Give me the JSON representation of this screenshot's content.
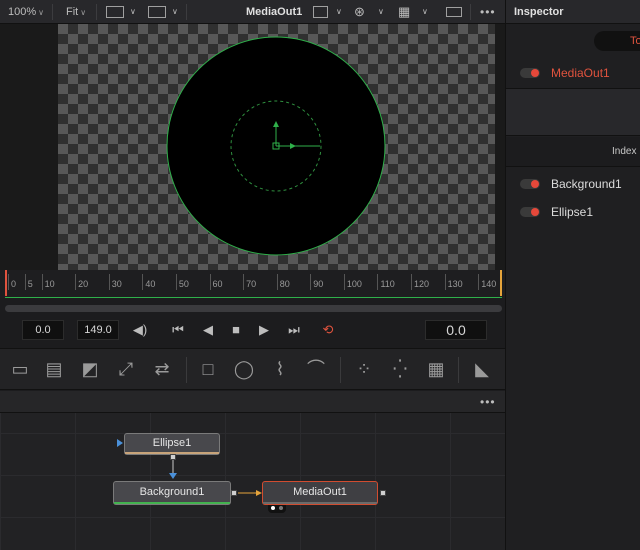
{
  "viewer_toolbar": {
    "zoom": "100%",
    "fit": "Fit",
    "title": "MediaOut1"
  },
  "viewer": {
    "circle_color": "#2fb04a",
    "canvas_bg": "checkerboard"
  },
  "timeline": {
    "ruler_labels": [
      "0",
      "5",
      "10",
      "20",
      "30",
      "40",
      "50",
      "60",
      "70",
      "80",
      "90",
      "100",
      "110",
      "120",
      "130",
      "140"
    ],
    "start": "0.0",
    "end": "149.0",
    "current": "0.0"
  },
  "transport": {
    "icons": [
      "speaker-icon",
      "rewind-icon",
      "play-reverse-icon",
      "stop-icon",
      "play-icon",
      "fast-forward-icon",
      "loop-icon"
    ]
  },
  "tools": {
    "icons": [
      "background-tool-icon",
      "merge-tool-icon",
      "image-plane-icon",
      "transform-tool-icon",
      "swap-tool-icon",
      "rectangle-mask-icon",
      "ellipse-mask-icon",
      "polygon-mask-icon",
      "bspline-mask-icon",
      "particle-emitter-icon",
      "particle-render-icon",
      "particle-style-icon",
      "3d-shape-icon"
    ]
  },
  "nodes": {
    "ellipse": "Ellipse1",
    "background": "Background1",
    "media_out": "MediaOut1",
    "ellipse_color": "#c8a47a",
    "background_color": "#43b34f",
    "media_out_border": "#d14c30"
  },
  "inspector": {
    "title": "Inspector",
    "tab": "To",
    "selected_node": "MediaOut1",
    "index_label": "Index",
    "items": [
      "Background1",
      "Ellipse1"
    ],
    "accent": "#e0533e"
  }
}
